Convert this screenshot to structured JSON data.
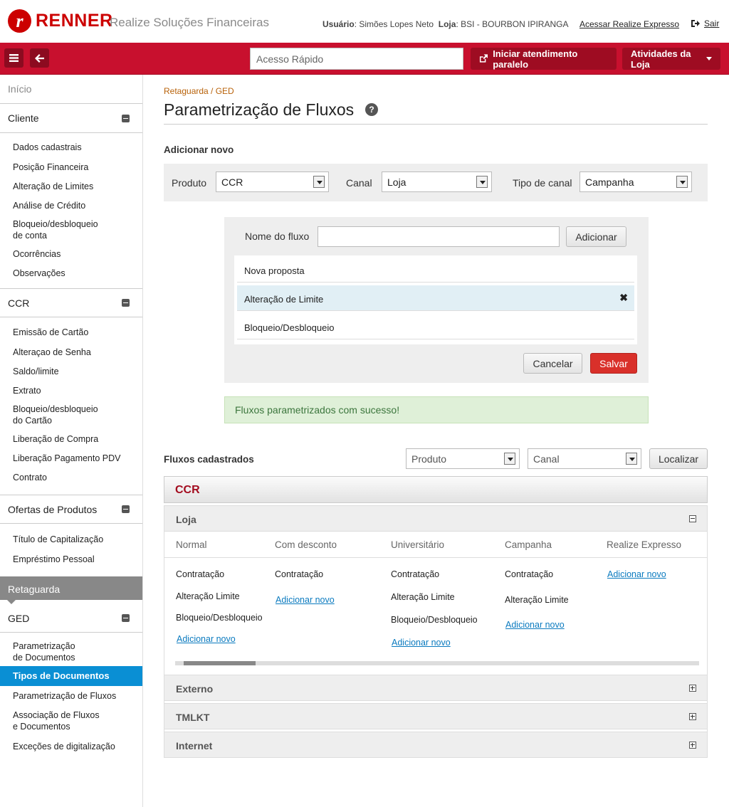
{
  "header": {
    "brand": "RENNER",
    "logo_letter": "r",
    "subtitle": "Realize Soluções Financeiras",
    "user_label": "Usuário",
    "user_name": "Simões Lopes Neto",
    "store_label": "Loja",
    "store_name": "BSI - BOURBON IPIRANGA",
    "express_link": "Acessar Realize Expresso",
    "logout": "Sair"
  },
  "toolbar": {
    "quick_placeholder": "Acesso Rápido",
    "parallel_btn": "Iniciar atendimento paralelo",
    "activities_btn": "Atividades da Loja"
  },
  "sidebar": {
    "inicio": "Início",
    "sections": [
      {
        "title": "Cliente",
        "items": [
          "Dados cadastrais",
          "Posição Financeira",
          "Alteração de Limites",
          "Análise de Crédito",
          "Bloqueio/desbloqueio\nde conta",
          "Ocorrências",
          "Observações"
        ]
      },
      {
        "title": "CCR",
        "items": [
          "Emissão de Cartão",
          "Alteraçao de Senha",
          "Saldo/limite",
          "Extrato",
          "Bloqueio/desbloqueio\ndo Cartão",
          "Liberação de Compra",
          "Liberação Pagamento PDV",
          "Contrato"
        ]
      },
      {
        "title": "Ofertas de Produtos",
        "items": [
          "Título de Capitalização",
          "Empréstimo Pessoal"
        ]
      }
    ],
    "retaguarda": "Retaguarda",
    "ged": {
      "title": "GED",
      "items": [
        "Parametrização\nde Documentos",
        "Tipos de Documentos",
        "Parametrização de Fluxos",
        "Associação de Fluxos\ne Documentos",
        "Exceções de digitalização"
      ]
    }
  },
  "main": {
    "breadcrumb": "Retaguarda / GED",
    "title": "Parametrização de Fluxos",
    "help": "?",
    "add_new": "Adicionar novo",
    "filters": {
      "produto_label": "Produto",
      "produto_value": "CCR",
      "canal_label": "Canal",
      "canal_value": "Loja",
      "tipo_label": "Tipo de canal",
      "tipo_value": "Campanha"
    },
    "flow_panel": {
      "name_label": "Nome do fluxo",
      "name_value": "",
      "add_btn": "Adicionar",
      "flows": [
        "Nova proposta",
        "Alteração de Limite",
        "Bloqueio/Desbloqueio"
      ],
      "cancel_btn": "Cancelar",
      "save_btn": "Salvar"
    },
    "success": "Fluxos parametrizados com sucesso!",
    "registered": {
      "title": "Fluxos cadastrados",
      "produto_ph": "Produto",
      "canal_ph": "Canal",
      "search_btn": "Localizar"
    },
    "product_group": "CCR",
    "loja": {
      "title": "Loja",
      "columns": [
        "Normal",
        "Com desconto",
        "Universitário",
        "Campanha",
        "Realize Expresso"
      ],
      "normal": [
        "Contratação",
        "Alteração Limite",
        "Bloqueio/Desbloqueio"
      ],
      "com_desconto": [
        "Contratação"
      ],
      "universitario": [
        "Contratação",
        "Alteração Limite",
        "Bloqueio/Desbloqueio"
      ],
      "campanha": [
        "Contratação",
        "Alteração Limite"
      ],
      "add_link": "Adicionar novo"
    },
    "other_channels": [
      "Externo",
      "TMLKT",
      "Internet"
    ]
  }
}
